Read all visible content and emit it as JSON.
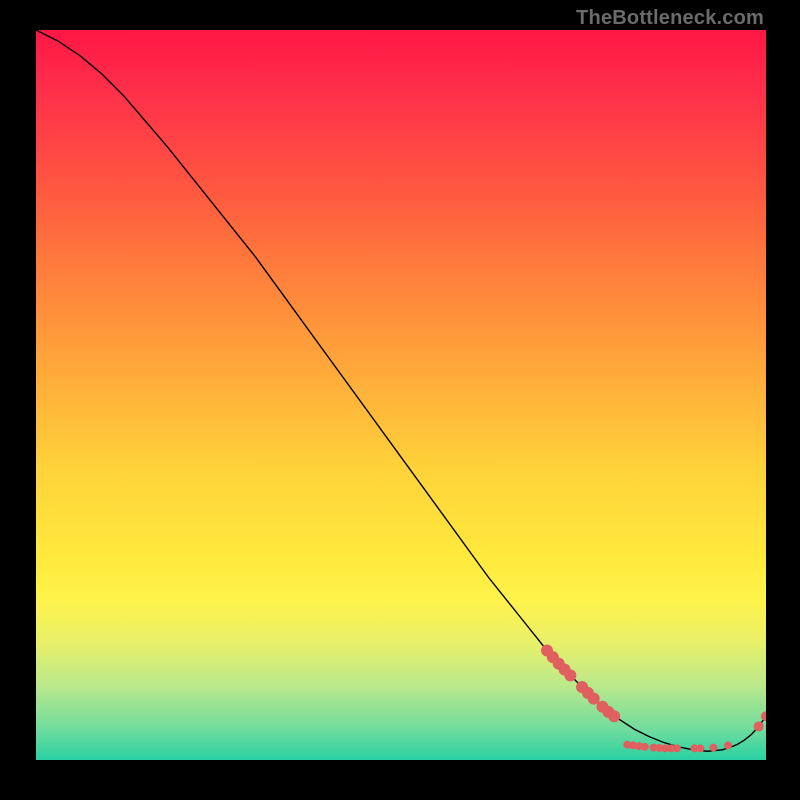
{
  "watermark": "TheBottleneck.com",
  "colors": {
    "curve_stroke": "#000000",
    "marker_fill": "#e06060",
    "gradient_top": "#ff1744",
    "gradient_bottom": "#28d0a4"
  },
  "chart_data": {
    "type": "line",
    "title": "",
    "xlabel": "",
    "ylabel": "",
    "xlim": [
      0,
      100
    ],
    "ylim": [
      0,
      100
    ],
    "grid": false,
    "legend": false,
    "series": [
      {
        "name": "bottleneck-curve",
        "x": [
          0,
          3,
          6,
          9,
          12,
          15,
          18,
          22,
          26,
          30,
          34,
          38,
          42,
          46,
          50,
          54,
          58,
          62,
          66,
          70,
          72,
          74,
          76,
          78,
          80,
          82,
          84,
          86,
          88,
          90,
          92,
          94,
          95,
          96,
          97,
          98,
          99,
          100
        ],
        "y": [
          100,
          98.5,
          96.5,
          94,
          91,
          87.5,
          84,
          79,
          74,
          69,
          63.5,
          58,
          52.5,
          47,
          41.5,
          36,
          30.5,
          25,
          20,
          15,
          12.8,
          10.8,
          8.8,
          7.0,
          5.5,
          4.2,
          3.2,
          2.4,
          1.8,
          1.4,
          1.2,
          1.4,
          1.7,
          2.1,
          2.7,
          3.5,
          4.6,
          6.0
        ]
      }
    ],
    "markers": {
      "series": "bottleneck-curve",
      "radius_large": 6,
      "radius_small": 4,
      "points": [
        {
          "x": 70.0,
          "y": 15.0,
          "r": 6
        },
        {
          "x": 70.8,
          "y": 14.1,
          "r": 6
        },
        {
          "x": 71.6,
          "y": 13.2,
          "r": 6
        },
        {
          "x": 72.4,
          "y": 12.4,
          "r": 6
        },
        {
          "x": 73.2,
          "y": 11.6,
          "r": 6
        },
        {
          "x": 74.8,
          "y": 10.0,
          "r": 6
        },
        {
          "x": 75.6,
          "y": 9.2,
          "r": 6
        },
        {
          "x": 76.4,
          "y": 8.4,
          "r": 6
        },
        {
          "x": 77.6,
          "y": 7.3,
          "r": 6
        },
        {
          "x": 78.4,
          "y": 6.6,
          "r": 6
        },
        {
          "x": 79.2,
          "y": 6.0,
          "r": 6
        },
        {
          "x": 81.0,
          "y": 2.1,
          "r": 4
        },
        {
          "x": 81.8,
          "y": 2.0,
          "r": 4
        },
        {
          "x": 82.6,
          "y": 1.9,
          "r": 4
        },
        {
          "x": 83.4,
          "y": 1.8,
          "r": 4
        },
        {
          "x": 84.6,
          "y": 1.7,
          "r": 4
        },
        {
          "x": 85.4,
          "y": 1.65,
          "r": 4
        },
        {
          "x": 86.2,
          "y": 1.6,
          "r": 4
        },
        {
          "x": 87.0,
          "y": 1.6,
          "r": 4
        },
        {
          "x": 87.8,
          "y": 1.6,
          "r": 4
        },
        {
          "x": 90.2,
          "y": 1.6,
          "r": 4
        },
        {
          "x": 91.0,
          "y": 1.6,
          "r": 4
        },
        {
          "x": 92.8,
          "y": 1.7,
          "r": 4
        },
        {
          "x": 94.8,
          "y": 2.0,
          "r": 4
        },
        {
          "x": 99.0,
          "y": 4.6,
          "r": 5
        },
        {
          "x": 100.0,
          "y": 6.0,
          "r": 5
        }
      ]
    }
  }
}
